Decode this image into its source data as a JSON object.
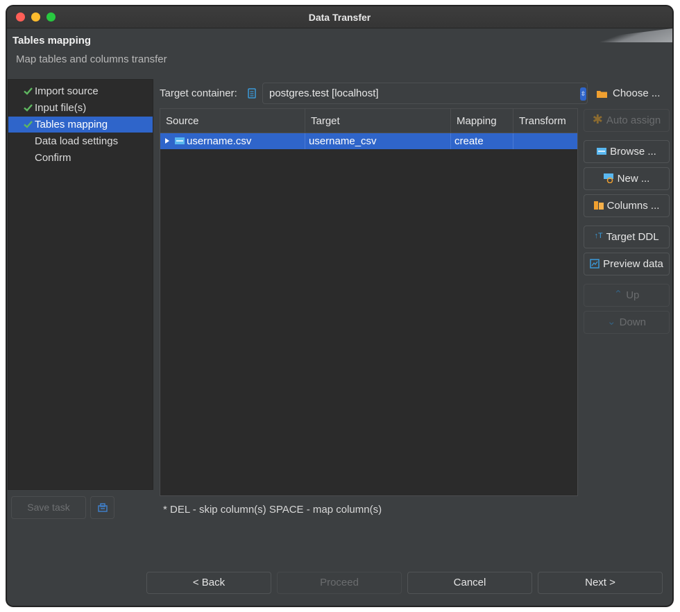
{
  "window": {
    "title": "Data Transfer"
  },
  "header": {
    "title": "Tables mapping",
    "description": "Map tables and columns transfer"
  },
  "sidebar": {
    "items": [
      {
        "label": "Import source",
        "done": true
      },
      {
        "label": "Input file(s)",
        "done": true
      },
      {
        "label": "Tables mapping",
        "done": true,
        "active": true
      },
      {
        "label": "Data load settings",
        "done": false
      },
      {
        "label": "Confirm",
        "done": false
      }
    ],
    "save_task_label": "Save task"
  },
  "target": {
    "label": "Target container:",
    "value": "postgres.test  [localhost]",
    "choose_label": "Choose ..."
  },
  "table": {
    "columns": [
      "Source",
      "Target",
      "Mapping",
      "Transform"
    ],
    "rows": [
      {
        "source": "username.csv",
        "target": "username_csv",
        "mapping": "create",
        "transform": ""
      }
    ]
  },
  "hint": "* DEL - skip column(s)  SPACE - map column(s)",
  "actions": {
    "auto_assign": "Auto assign",
    "browse": "Browse ...",
    "new": "New ...",
    "columns": "Columns ...",
    "target_ddl": "Target DDL",
    "preview_data": "Preview data",
    "up": "Up",
    "down": "Down"
  },
  "footer": {
    "back": "< Back",
    "proceed": "Proceed",
    "cancel": "Cancel",
    "next": "Next >"
  },
  "colors": {
    "accent": "#2f65ca",
    "check": "#5fb760",
    "folder": "#f0a030"
  }
}
